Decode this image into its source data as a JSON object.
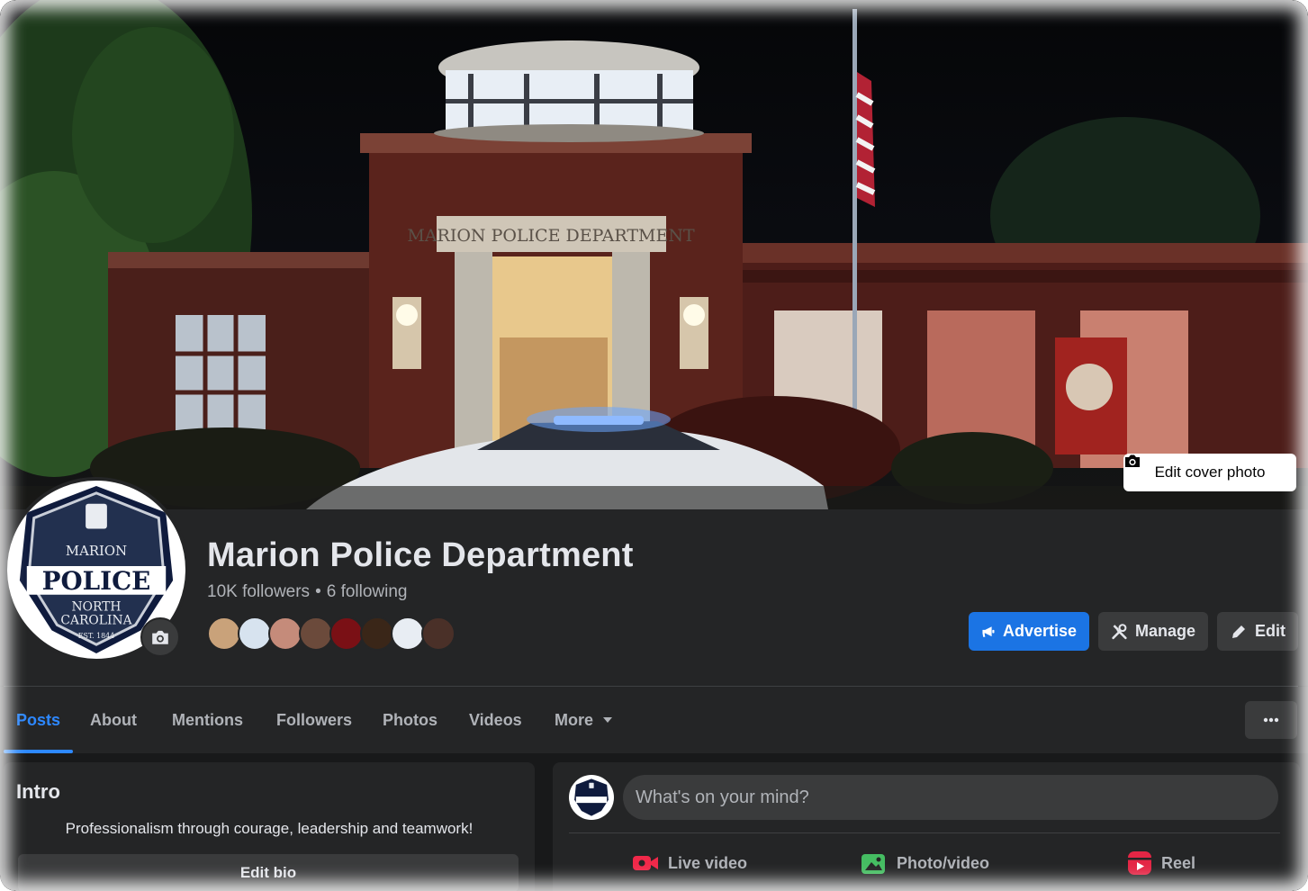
{
  "cover": {
    "building_sign": "MARION POLICE DEPARTMENT",
    "edit_cover_label": "Edit cover photo"
  },
  "profile": {
    "logo_top": "MARION",
    "logo_main": "POLICE",
    "logo_sub1": "NORTH",
    "logo_sub2": "CAROLINA",
    "logo_est": "EST. 1844",
    "title": "Marion Police Department",
    "followers": "10K followers",
    "following": "6 following",
    "separator": "•"
  },
  "follower_avatar_colors": [
    "#c9a27a",
    "#d7e3ef",
    "#c58b7a",
    "#6b4a3b",
    "#7a1015",
    "#3a2618",
    "#e8edf3",
    "#4a3028"
  ],
  "actions": {
    "advertise": "Advertise",
    "manage": "Manage",
    "edit": "Edit"
  },
  "tabs": [
    {
      "label": "Posts",
      "active": true
    },
    {
      "label": "About"
    },
    {
      "label": "Mentions"
    },
    {
      "label": "Followers"
    },
    {
      "label": "Photos"
    },
    {
      "label": "Videos"
    },
    {
      "label": "More"
    }
  ],
  "intro": {
    "title": "Intro",
    "bio": "Professionalism through courage, leadership and teamwork!",
    "edit_bio": "Edit bio"
  },
  "composer": {
    "placeholder": "What's on your mind?",
    "live_video": "Live video",
    "photo_video": "Photo/video",
    "reel": "Reel"
  },
  "colors": {
    "accent": "#1b74e4",
    "tab_active": "#2d88ff",
    "surface": "#242526",
    "background": "#18191a",
    "button": "#3a3b3c"
  }
}
